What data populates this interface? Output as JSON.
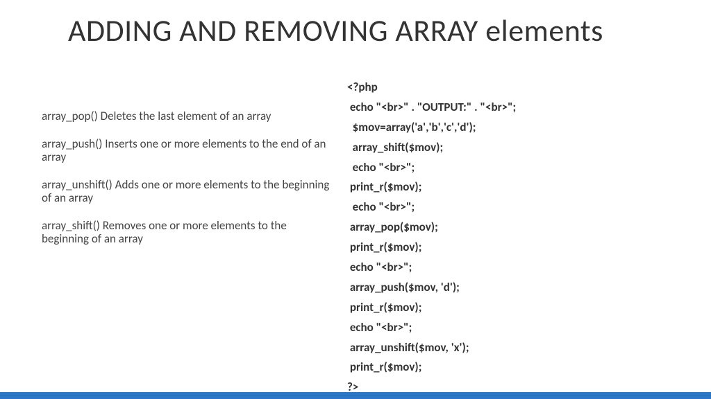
{
  "title": "ADDING AND REMOVING ARRAY elements",
  "functions": [
    {
      "text": "array_pop()        Deletes the last element of an array"
    },
    {
      "text": "array_push()                     Inserts one or more elements to the end of an array"
    },
    {
      "text": "array_unshift()   Adds one or more elements to the beginning of an array"
    },
    {
      "text": "array_shift()                      Removes one or more elements to the beginning of an array"
    }
  ],
  "code": [
    "<?php",
    " echo \"<br>\" . \"OUTPUT:\" . \"<br>\";",
    "  $mov=array('a','b','c','d');",
    "  array_shift($mov);",
    "  echo \"<br>\";",
    " print_r($mov);",
    "  echo \"<br>\";",
    " array_pop($mov);",
    " print_r($mov);",
    " echo \"<br>\";",
    " array_push($mov, 'd');",
    " print_r($mov);",
    " echo \"<br>\";",
    " array_unshift($mov, 'x');",
    " print_r($mov);",
    "?>"
  ]
}
